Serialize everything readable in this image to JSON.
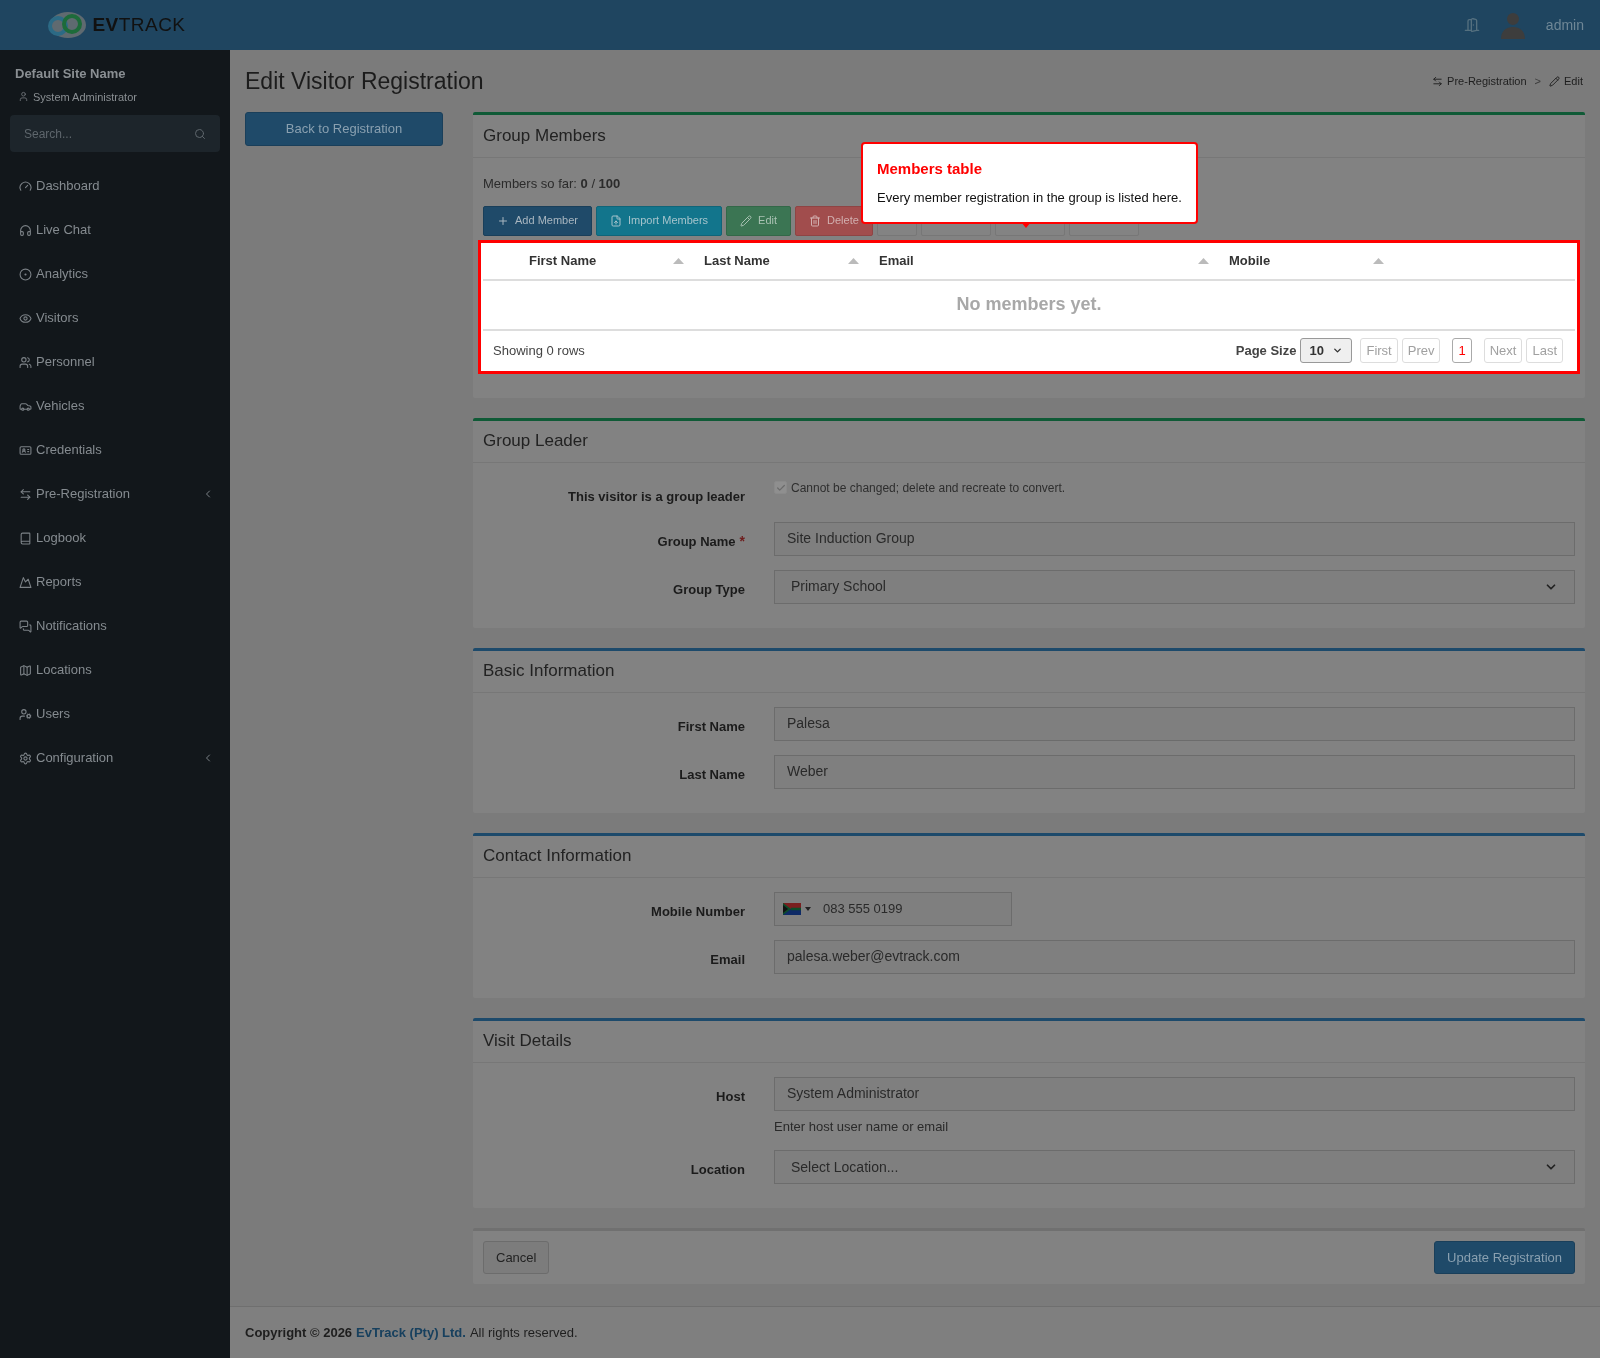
{
  "header": {
    "logo": "**EV**TRACK",
    "user": "admin"
  },
  "sidebar": {
    "site": "Default Site Name",
    "role": "System Administrator",
    "search_placeholder": "Search...",
    "items": [
      {
        "label": "Dashboard",
        "expandable": false
      },
      {
        "label": "Live Chat",
        "expandable": false
      },
      {
        "label": "Analytics",
        "expandable": false
      },
      {
        "label": "Visitors",
        "expandable": false
      },
      {
        "label": "Personnel",
        "expandable": false
      },
      {
        "label": "Vehicles",
        "expandable": false
      },
      {
        "label": "Credentials",
        "expandable": false
      },
      {
        "label": "Pre-Registration",
        "expandable": true
      },
      {
        "label": "Logbook",
        "expandable": false
      },
      {
        "label": "Reports",
        "expandable": false
      },
      {
        "label": "Notifications",
        "expandable": false
      },
      {
        "label": "Locations",
        "expandable": false
      },
      {
        "label": "Users",
        "expandable": false
      },
      {
        "label": "Configuration",
        "expandable": true
      }
    ]
  },
  "page": {
    "title": "Edit Visitor Registration",
    "breadcrumb": [
      "Pre-Registration",
      "Edit"
    ],
    "breadcrumb_separator": ">",
    "back_button": "Back to Registration"
  },
  "group_members": {
    "title": "Group Members",
    "color": "#0f5a36",
    "count": "Members so far: **0** / **100**",
    "toolbar": [
      {
        "label": "Add Member",
        "kind": "primary"
      },
      {
        "label": "Import Members",
        "kind": "info"
      },
      {
        "label": "Edit",
        "kind": "success"
      },
      {
        "label": "Delete",
        "kind": "danger"
      }
    ],
    "table": {
      "columns": [
        "First Name",
        "Last Name",
        "Email",
        "Mobile"
      ],
      "empty": "No members yet.",
      "showing": "Showing 0 rows",
      "page_size_label": "Page Size",
      "page_size": "10",
      "pager": [
        {
          "label": "First",
          "disabled": true,
          "selected": false
        },
        {
          "label": "Prev",
          "disabled": true,
          "selected": false
        },
        {
          "label": "1",
          "disabled": false,
          "selected": true
        },
        {
          "label": "Next",
          "disabled": true,
          "selected": false
        },
        {
          "label": "Last",
          "disabled": true,
          "selected": false
        }
      ]
    },
    "tour": {
      "title": "Members table",
      "text": "Every member registration in the group is listed here."
    }
  },
  "sections": [
    {
      "title": "Group Leader",
      "color": "#0f5a36",
      "fields": [
        {
          "kind": "checkbox",
          "label": "This visitor is a group leader",
          "checked": true,
          "disabled": true,
          "note": "Cannot be changed; delete and recreate to convert."
        },
        {
          "kind": "text",
          "label": "Group Name",
          "required_mark": "*",
          "value": "Site Induction Group"
        },
        {
          "kind": "select",
          "label": "Group Type",
          "value": "Primary School"
        }
      ]
    },
    {
      "title": "Basic Information",
      "color": "#1d4a6b",
      "fields": [
        {
          "kind": "text",
          "label": "First Name",
          "value": "Palesa"
        },
        {
          "kind": "text",
          "label": "Last Name",
          "value": "Weber"
        }
      ]
    },
    {
      "title": "Contact Information",
      "color": "#1d4a6b",
      "fields": [
        {
          "kind": "phone",
          "label": "Mobile Number",
          "value": "083 555 0199"
        },
        {
          "kind": "text",
          "label": "Email",
          "value": "palesa.weber@evtrack.com"
        }
      ]
    },
    {
      "title": "Visit Details",
      "color": "#1d4a6b",
      "fields": [
        {
          "kind": "text",
          "label": "Host",
          "value": "System Administrator",
          "help": "Enter host user name or email"
        },
        {
          "kind": "select",
          "label": "Location",
          "value": "Select Location..."
        }
      ]
    }
  ],
  "actions": {
    "cancel": "Cancel",
    "submit": "Update Registration"
  },
  "footer": {
    "prefix": "Copyright © 2026",
    "link": "EvTrack (Pty) Ltd.",
    "suffix": "All rights reserved."
  }
}
